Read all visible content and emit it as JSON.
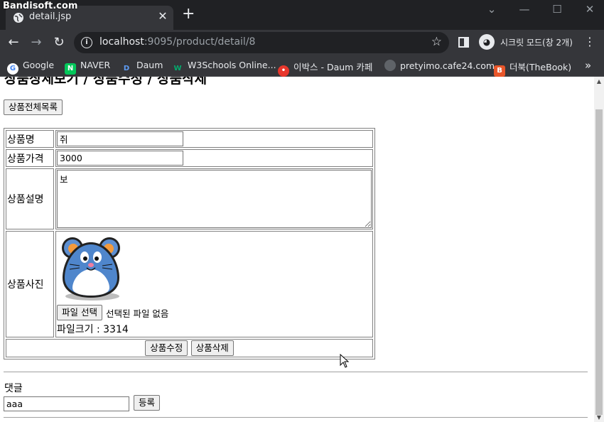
{
  "watermark": "Bandisoft.com",
  "browser": {
    "tab_title": "detail.jsp",
    "tab_close": "✕",
    "new_tab": "+",
    "url_host": "localhost",
    "url_path": ":9095/product/detail/8",
    "incognito_label": "시크릿 모드(창 2개)",
    "bookmarks": [
      {
        "label": "Google",
        "icon": "google-icon",
        "color": "#4285f4",
        "glyph": "G"
      },
      {
        "label": "NAVER",
        "icon": "naver-icon",
        "color": "#03c75a",
        "glyph": "N"
      },
      {
        "label": "Daum",
        "icon": "daum-icon",
        "color": "#ff5a4a",
        "glyph": "D"
      },
      {
        "label": "W3Schools Online...",
        "icon": "w3schools-icon",
        "color": "#04aa6d",
        "glyph": "W"
      },
      {
        "label": "이박스 - Daum 카페",
        "icon": "daum-cafe-icon",
        "color": "#e8372c",
        "glyph": "●"
      },
      {
        "label": "pretyimo.cafe24.com",
        "icon": "globe-icon",
        "color": "#5f6368",
        "glyph": "◐"
      },
      {
        "label": "더북(TheBook)",
        "icon": "thebook-icon",
        "color": "#e8562a",
        "glyph": "B"
      }
    ]
  },
  "page": {
    "heading": "상품상세보기 / 상품수정 / 상품삭제",
    "list_button": "상품전체목록",
    "form": {
      "name_label": "상품명",
      "name_value": "쥐",
      "price_label": "상품가격",
      "price_value": "3000",
      "desc_label": "상품설명",
      "desc_value": "보",
      "photo_label": "상품사진",
      "file_button": "파일 선택",
      "file_status": "선택된 파일 없음",
      "file_size": "파일크기 : 3314",
      "update_button": "상품수정",
      "delete_button": "상품삭제"
    },
    "comment": {
      "title": "댓글",
      "input_value": "aaa",
      "submit_button": "등록"
    }
  }
}
